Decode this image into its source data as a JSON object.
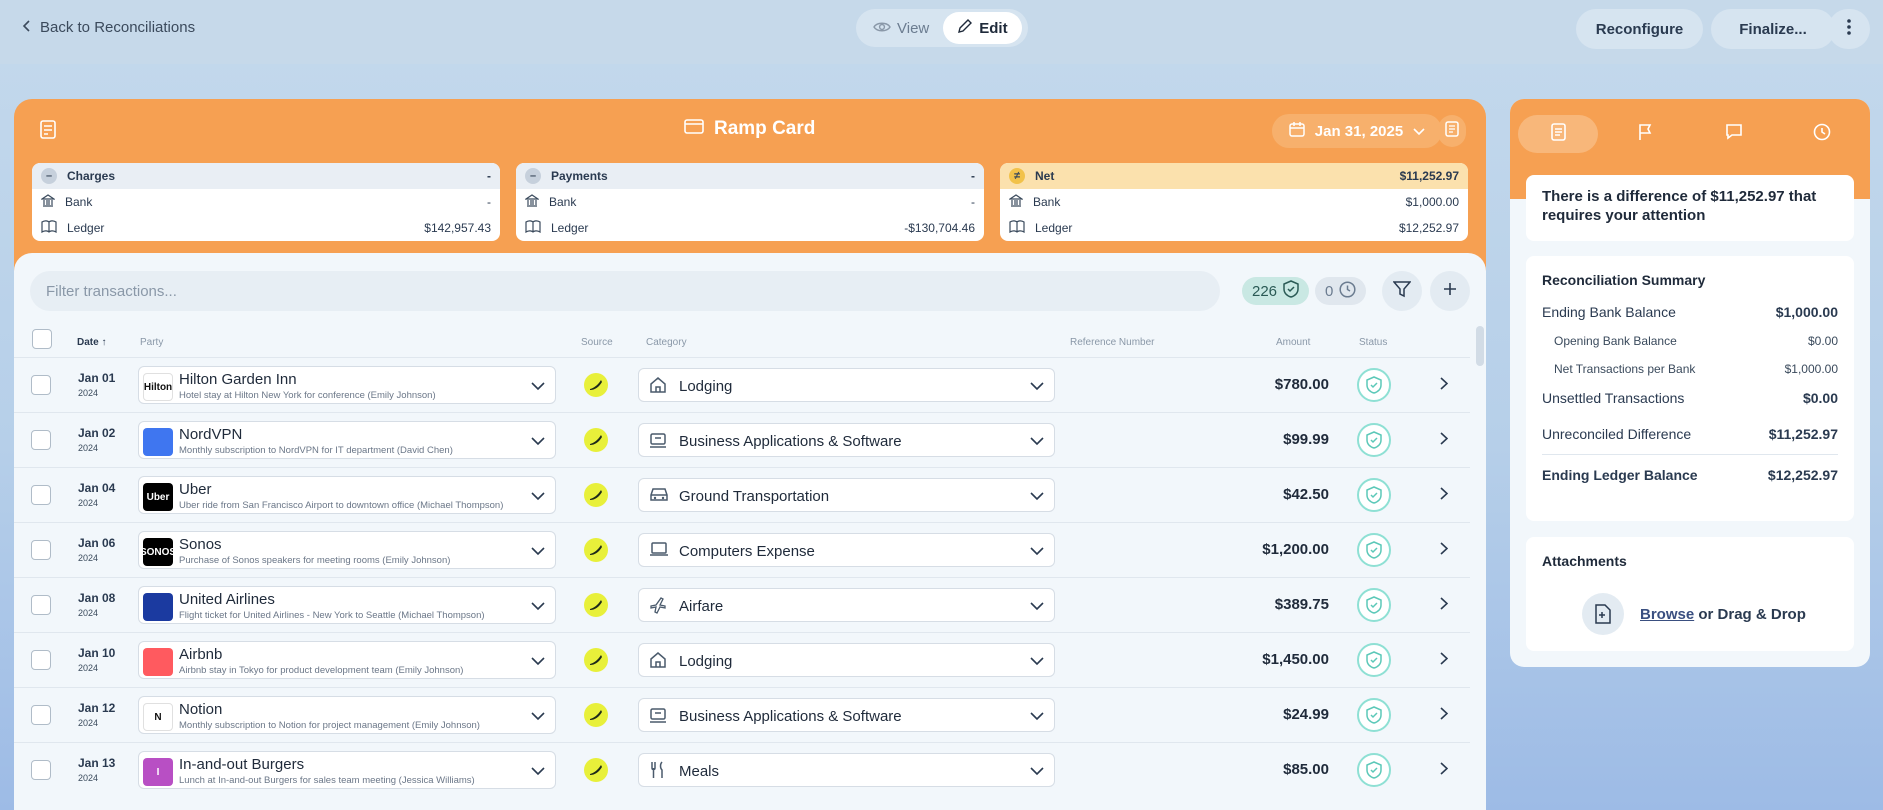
{
  "nav": {
    "back_label": "Back to Reconciliations"
  },
  "mode": {
    "view_label": "View",
    "edit_label": "Edit",
    "active": "Edit"
  },
  "actions": {
    "reconfigure_label": "Reconfigure",
    "finalize_label": "Finalize..."
  },
  "account": {
    "title": "Ramp Card",
    "date_label": "Jan 31, 2025"
  },
  "summary_cards": {
    "charges": {
      "label": "Charges",
      "total": "-",
      "bank_label": "Bank",
      "bank": "-",
      "ledger_label": "Ledger",
      "ledger": "$142,957.43"
    },
    "payments": {
      "label": "Payments",
      "total": "-",
      "bank_label": "Bank",
      "bank": "-",
      "ledger_label": "Ledger",
      "ledger": "-$130,704.46"
    },
    "net": {
      "label": "Net",
      "total": "$11,252.97",
      "bank_label": "Bank",
      "bank": "$1,000.00",
      "ledger_label": "Ledger",
      "ledger": "$12,252.97"
    }
  },
  "toolbar": {
    "filter_placeholder": "Filter transactions...",
    "reconciled_count": "226",
    "pending_count": "0"
  },
  "columns": {
    "date": "Date",
    "party": "Party",
    "source": "Source",
    "category": "Category",
    "reference": "Reference Number",
    "amount": "Amount",
    "status": "Status"
  },
  "transactions": [
    {
      "date": "Jan 01",
      "year": "2024",
      "party": "Hilton Garden Inn",
      "desc": "Hotel stay at Hilton New York for conference (Emily Johnson)",
      "category": "Lodging",
      "amount": "$780.00",
      "logo_text": "Hilton",
      "logo_color": "#ffffff",
      "cat_icon": "home-icon"
    },
    {
      "date": "Jan 02",
      "year": "2024",
      "party": "NordVPN",
      "desc": "Monthly subscription to NordVPN for IT department (David Chen)",
      "category": "Business Applications & Software",
      "amount": "$99.99",
      "logo_text": "",
      "logo_color": "#3f76f0",
      "cat_icon": "apps-icon"
    },
    {
      "date": "Jan 04",
      "year": "2024",
      "party": "Uber",
      "desc": "Uber ride from San Francisco Airport to downtown office (Michael Thompson)",
      "category": "Ground Transportation",
      "amount": "$42.50",
      "logo_text": "Uber",
      "logo_color": "#000000",
      "cat_icon": "car-icon"
    },
    {
      "date": "Jan 06",
      "year": "2024",
      "party": "Sonos",
      "desc": "Purchase of Sonos speakers for meeting rooms (Emily Johnson)",
      "category": "Computers Expense",
      "amount": "$1,200.00",
      "logo_text": "SONOS",
      "logo_color": "#000000",
      "cat_icon": "laptop-icon"
    },
    {
      "date": "Jan 08",
      "year": "2024",
      "party": "United Airlines",
      "desc": "Flight ticket for United Airlines - New York to Seattle (Michael Thompson)",
      "category": "Airfare",
      "amount": "$389.75",
      "logo_text": "",
      "logo_color": "#1b3aa0",
      "cat_icon": "plane-icon"
    },
    {
      "date": "Jan 10",
      "year": "2024",
      "party": "Airbnb",
      "desc": "Airbnb stay in Tokyo for product development team (Emily Johnson)",
      "category": "Lodging",
      "amount": "$1,450.00",
      "logo_text": "",
      "logo_color": "#ff5a5f",
      "cat_icon": "home-icon"
    },
    {
      "date": "Jan 12",
      "year": "2024",
      "party": "Notion",
      "desc": "Monthly subscription to Notion for project management (Emily Johnson)",
      "category": "Business Applications & Software",
      "amount": "$24.99",
      "logo_text": "N",
      "logo_color": "#ffffff",
      "cat_icon": "apps-icon"
    },
    {
      "date": "Jan 13",
      "year": "2024",
      "party": "In-and-out Burgers",
      "desc": "Lunch at In-and-out Burgers for sales team meeting (Jessica Williams)",
      "category": "Meals",
      "amount": "$85.00",
      "logo_text": "I",
      "logo_color": "#b84fc4",
      "cat_icon": "utensils-icon"
    }
  ],
  "panel": {
    "alert": "There is a difference of $11,252.97 that requires your attention",
    "summary_title": "Reconciliation Summary",
    "ending_bank_label": "Ending Bank Balance",
    "ending_bank": "$1,000.00",
    "opening_bank_label": "Opening Bank Balance",
    "opening_bank": "$0.00",
    "net_bank_label": "Net Transactions per Bank",
    "net_bank": "$1,000.00",
    "unsettled_label": "Unsettled Transactions",
    "unsettled": "$0.00",
    "unreconciled_label": "Unreconciled Difference",
    "unreconciled": "$11,252.97",
    "ending_ledger_label": "Ending Ledger Balance",
    "ending_ledger": "$12,252.97",
    "attachments_title": "Attachments",
    "browse_label": "Browse",
    "drop_label": "or Drag & Drop"
  }
}
